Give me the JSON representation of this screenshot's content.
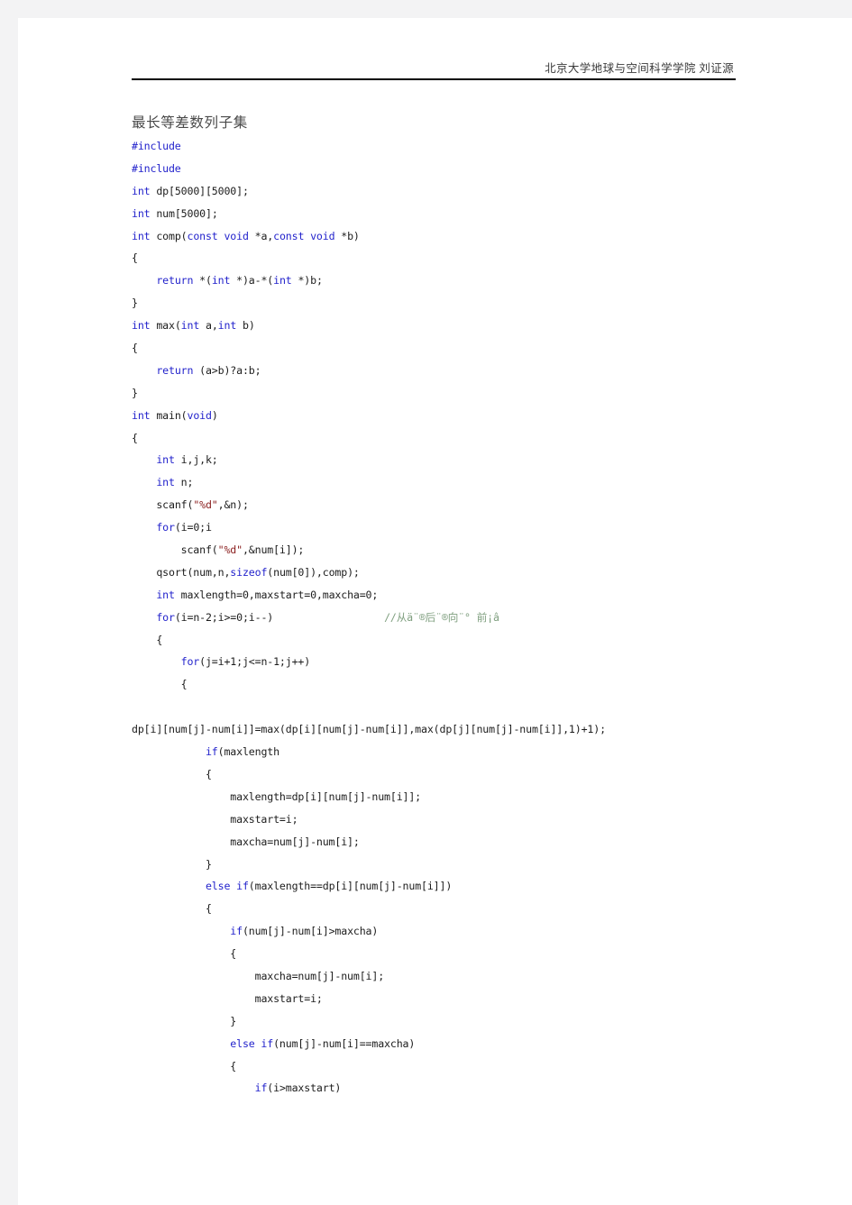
{
  "document": {
    "header": {
      "institution_line": "北京大学地球与空间科学学院  刘证源"
    },
    "title": "最长等差数列子集",
    "colors": {
      "keyword": "#2323CC",
      "string": "#8B2020",
      "comment": "#7F9F7F",
      "plain": "#1C1C1C",
      "title": "#4A4A4A",
      "header": "#3A3A3A",
      "page_background": "#FFFFFF",
      "canvas_background": "#F3F3F4",
      "rule": "#000000"
    },
    "code": {
      "language": "c",
      "lines": [
        {
          "indent": 0,
          "tokens": [
            {
              "t": "pp",
              "v": "#include"
            }
          ]
        },
        {
          "indent": 0,
          "tokens": [
            {
              "t": "pp",
              "v": "#include"
            }
          ]
        },
        {
          "indent": 0,
          "tokens": [
            {
              "t": "kw",
              "v": "int"
            },
            {
              "t": "pl",
              "v": " dp"
            },
            {
              "t": "br",
              "v": "[5000][5000]"
            },
            {
              "t": "pl",
              "v": ";"
            }
          ]
        },
        {
          "indent": 0,
          "tokens": [
            {
              "t": "kw",
              "v": "int"
            },
            {
              "t": "pl",
              "v": " num"
            },
            {
              "t": "br",
              "v": "[5000]"
            },
            {
              "t": "pl",
              "v": ";"
            }
          ]
        },
        {
          "indent": 0,
          "tokens": [
            {
              "t": "kw",
              "v": "int"
            },
            {
              "t": "pl",
              "v": " comp("
            },
            {
              "t": "kw",
              "v": "const void"
            },
            {
              "t": "pl",
              "v": " *a,"
            },
            {
              "t": "kw",
              "v": "const void"
            },
            {
              "t": "pl",
              "v": " *b)"
            }
          ]
        },
        {
          "indent": 0,
          "tokens": [
            {
              "t": "pl",
              "v": "{"
            }
          ]
        },
        {
          "indent": 1,
          "tokens": [
            {
              "t": "kw",
              "v": "return"
            },
            {
              "t": "pl",
              "v": " *("
            },
            {
              "t": "kw",
              "v": "int"
            },
            {
              "t": "pl",
              "v": " *)a-*("
            },
            {
              "t": "kw",
              "v": "int"
            },
            {
              "t": "pl",
              "v": " *)b;"
            }
          ]
        },
        {
          "indent": 0,
          "tokens": [
            {
              "t": "pl",
              "v": "}"
            }
          ]
        },
        {
          "indent": 0,
          "tokens": [
            {
              "t": "kw",
              "v": "int"
            },
            {
              "t": "pl",
              "v": " max("
            },
            {
              "t": "kw",
              "v": "int"
            },
            {
              "t": "pl",
              "v": " a,"
            },
            {
              "t": "kw",
              "v": "int"
            },
            {
              "t": "pl",
              "v": " b)"
            }
          ]
        },
        {
          "indent": 0,
          "tokens": [
            {
              "t": "pl",
              "v": "{"
            }
          ]
        },
        {
          "indent": 1,
          "tokens": [
            {
              "t": "kw",
              "v": "return"
            },
            {
              "t": "pl",
              "v": " (a>b)?a:b;"
            }
          ]
        },
        {
          "indent": 0,
          "tokens": [
            {
              "t": "pl",
              "v": "}"
            }
          ]
        },
        {
          "indent": 0,
          "tokens": [
            {
              "t": "kw",
              "v": "int"
            },
            {
              "t": "pl",
              "v": " main("
            },
            {
              "t": "kw",
              "v": "void"
            },
            {
              "t": "pl",
              "v": ")"
            }
          ]
        },
        {
          "indent": 0,
          "tokens": [
            {
              "t": "pl",
              "v": "{"
            }
          ]
        },
        {
          "indent": 1,
          "tokens": [
            {
              "t": "kw",
              "v": "int"
            },
            {
              "t": "pl",
              "v": " i,j,k;"
            }
          ]
        },
        {
          "indent": 1,
          "tokens": [
            {
              "t": "kw",
              "v": "int"
            },
            {
              "t": "pl",
              "v": " n;"
            }
          ]
        },
        {
          "indent": 1,
          "tokens": [
            {
              "t": "pl",
              "v": "scanf("
            },
            {
              "t": "str",
              "v": "\"%d\""
            },
            {
              "t": "pl",
              "v": ",&n);"
            }
          ]
        },
        {
          "indent": 1,
          "tokens": [
            {
              "t": "kw",
              "v": "for"
            },
            {
              "t": "pl",
              "v": "(i=0;i"
            }
          ]
        },
        {
          "indent": 2,
          "tokens": [
            {
              "t": "pl",
              "v": "scanf("
            },
            {
              "t": "str",
              "v": "\"%d\""
            },
            {
              "t": "pl",
              "v": ",&num[i]);"
            }
          ]
        },
        {
          "indent": 1,
          "tokens": [
            {
              "t": "pl",
              "v": "qsort(num,n,"
            },
            {
              "t": "kw",
              "v": "sizeof"
            },
            {
              "t": "pl",
              "v": "(num[0]),comp);"
            }
          ]
        },
        {
          "indent": 1,
          "tokens": [
            {
              "t": "kw",
              "v": "int"
            },
            {
              "t": "pl",
              "v": " maxlength=0,maxstart=0,maxcha=0;"
            }
          ]
        },
        {
          "indent": 1,
          "tokens": [
            {
              "t": "kw",
              "v": "for"
            },
            {
              "t": "pl",
              "v": "(i=n-2;i>=0;i--)"
            },
            {
              "t": "pl",
              "v": "                  "
            },
            {
              "t": "com",
              "v": "//从ä¨®后¨®向¨° 前¡â"
            }
          ]
        },
        {
          "indent": 1,
          "tokens": [
            {
              "t": "pl",
              "v": "{"
            }
          ]
        },
        {
          "indent": 2,
          "tokens": [
            {
              "t": "kw",
              "v": "for"
            },
            {
              "t": "pl",
              "v": "(j=i+1;j<=n-1;j++)"
            }
          ]
        },
        {
          "indent": 2,
          "tokens": [
            {
              "t": "pl",
              "v": "{"
            }
          ]
        },
        {
          "indent": 0,
          "tokens": [
            {
              "t": "pl",
              "v": ""
            }
          ]
        },
        {
          "indent": 0,
          "tokens": [
            {
              "t": "pl",
              "v": "dp[i][num[j]-num[i]]=max(dp[i][num[j]-num[i]],max(dp[j][num[j]-num[i]],1)+1);"
            }
          ]
        },
        {
          "indent": 3,
          "tokens": [
            {
              "t": "kw",
              "v": "if"
            },
            {
              "t": "pl",
              "v": "(maxlength"
            }
          ]
        },
        {
          "indent": 3,
          "tokens": [
            {
              "t": "pl",
              "v": "{"
            }
          ]
        },
        {
          "indent": 4,
          "tokens": [
            {
              "t": "pl",
              "v": "maxlength=dp[i][num[j]-num[i]];"
            }
          ]
        },
        {
          "indent": 4,
          "tokens": [
            {
              "t": "pl",
              "v": "maxstart=i;"
            }
          ]
        },
        {
          "indent": 4,
          "tokens": [
            {
              "t": "pl",
              "v": "maxcha=num[j]-num[i];"
            }
          ]
        },
        {
          "indent": 3,
          "tokens": [
            {
              "t": "pl",
              "v": "}"
            }
          ]
        },
        {
          "indent": 3,
          "tokens": [
            {
              "t": "kw",
              "v": "else if"
            },
            {
              "t": "pl",
              "v": "(maxlength==dp[i][num[j]-num[i]])"
            }
          ]
        },
        {
          "indent": 3,
          "tokens": [
            {
              "t": "pl",
              "v": "{"
            }
          ]
        },
        {
          "indent": 4,
          "tokens": [
            {
              "t": "kw",
              "v": "if"
            },
            {
              "t": "pl",
              "v": "(num[j]-num[i]>maxcha)"
            }
          ]
        },
        {
          "indent": 4,
          "tokens": [
            {
              "t": "pl",
              "v": "{"
            }
          ]
        },
        {
          "indent": 5,
          "tokens": [
            {
              "t": "pl",
              "v": "maxcha=num[j]-num[i];"
            }
          ]
        },
        {
          "indent": 5,
          "tokens": [
            {
              "t": "pl",
              "v": "maxstart=i;"
            }
          ]
        },
        {
          "indent": 4,
          "tokens": [
            {
              "t": "pl",
              "v": "}"
            }
          ]
        },
        {
          "indent": 4,
          "tokens": [
            {
              "t": "kw",
              "v": "else if"
            },
            {
              "t": "pl",
              "v": "(num[j]-num[i]==maxcha)"
            }
          ]
        },
        {
          "indent": 4,
          "tokens": [
            {
              "t": "pl",
              "v": "{"
            }
          ]
        },
        {
          "indent": 5,
          "tokens": [
            {
              "t": "kw",
              "v": "if"
            },
            {
              "t": "pl",
              "v": "(i>maxstart)"
            }
          ]
        }
      ]
    }
  }
}
